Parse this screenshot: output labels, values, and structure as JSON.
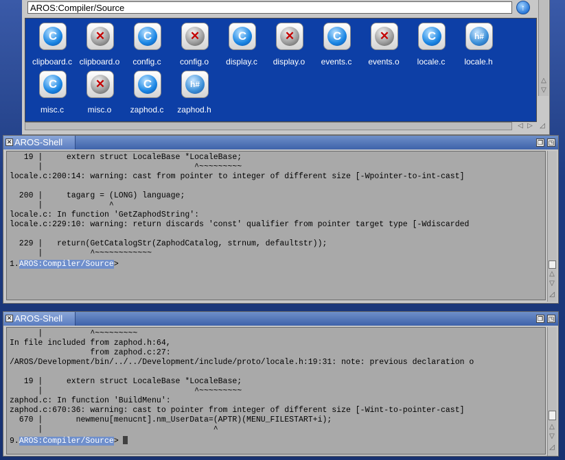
{
  "drawer": {
    "path": "AROS:Compiler/Source",
    "parent_button": "↑",
    "icons": [
      {
        "label": "clipboard.c",
        "type": "c"
      },
      {
        "label": "clipboard.o",
        "type": "o"
      },
      {
        "label": "config.c",
        "type": "c"
      },
      {
        "label": "config.o",
        "type": "o"
      },
      {
        "label": "display.c",
        "type": "c"
      },
      {
        "label": "display.o",
        "type": "o"
      },
      {
        "label": "events.c",
        "type": "c"
      },
      {
        "label": "events.o",
        "type": "o"
      },
      {
        "label": "locale.c",
        "type": "c"
      },
      {
        "label": "locale.h",
        "type": "h"
      },
      {
        "label": "misc.c",
        "type": "c"
      },
      {
        "label": "misc.o",
        "type": "o"
      },
      {
        "label": "zaphod.c",
        "type": "c"
      },
      {
        "label": "zaphod.h",
        "type": "h"
      }
    ],
    "glyphs": {
      "c": "C",
      "o": "✕",
      "h": "h#"
    }
  },
  "shell1": {
    "title": "AROS-Shell",
    "lines": [
      "   19 |     extern struct LocaleBase *LocaleBase;",
      "      |                                ^~~~~~~~~~",
      "locale.c:200:14: warning: cast from pointer to integer of different size [-Wpointer-to-int-cast]",
      "",
      "  200 |     tagarg = (LONG) language;",
      "      |              ^",
      "locale.c: In function 'GetZaphodString':",
      "locale.c:229:10: warning: return discards 'const' qualifier from pointer target type [-Wdiscarded",
      "",
      "  229 |   return(GetCatalogStr(ZaphodCatalog, strnum, defaultstr));",
      "      |          ^~~~~~~~~~~~~"
    ],
    "prompt_num": "1.",
    "prompt_path": "AROS:Compiler/Source",
    "prompt_end": ">"
  },
  "shell2": {
    "title": "AROS-Shell",
    "lines": [
      "      |          ^~~~~~~~~~",
      "In file included from zaphod.h:64,",
      "                 from zaphod.c:27:",
      "/AROS/Development/bin/../../Development/include/proto/locale.h:19:31: note: previous declaration o",
      "",
      "   19 |     extern struct LocaleBase *LocaleBase;",
      "      |                                ^~~~~~~~~~",
      "zaphod.c: In function 'BuildMenu':",
      "zaphod.c:670:36: warning: cast to pointer from integer of different size [-Wint-to-pointer-cast]",
      "  670 |       newmenu[menucnt].nm_UserData=(APTR)(MENU_FILESTART+i);",
      "      |                                    ^"
    ],
    "prompt_num": "9.",
    "prompt_path": "AROS:Compiler/Source",
    "prompt_end": ">"
  },
  "scroll_arrows": {
    "up": "△",
    "down": "▽",
    "left": "◁",
    "right": "▷",
    "resize": "◿"
  },
  "title_gadgets": {
    "close": "✕",
    "depth": "❐",
    "zoom": "◳"
  }
}
